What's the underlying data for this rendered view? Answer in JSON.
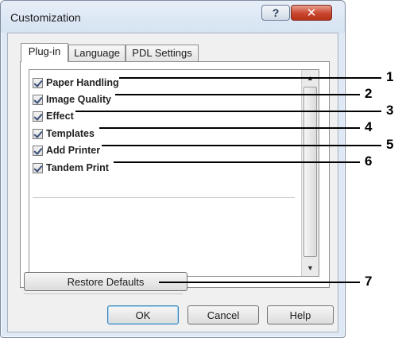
{
  "window": {
    "title": "Customization",
    "help_glyph": "?",
    "close_glyph": "✕"
  },
  "tabs": [
    {
      "label": "Plug-in",
      "active": true
    },
    {
      "label": "Language",
      "active": false
    },
    {
      "label": "PDL Settings",
      "active": false
    }
  ],
  "plugins": [
    {
      "label": "Paper Handling",
      "checked": true
    },
    {
      "label": "Image Quality",
      "checked": true
    },
    {
      "label": "Effect",
      "checked": true
    },
    {
      "label": "Templates",
      "checked": true
    },
    {
      "label": "Add Printer",
      "checked": true
    },
    {
      "label": "Tandem Print",
      "checked": true
    }
  ],
  "buttons": {
    "restore_defaults": "Restore Defaults",
    "ok": "OK",
    "cancel": "Cancel",
    "help": "Help"
  },
  "callouts": [
    "1",
    "2",
    "3",
    "4",
    "5",
    "6",
    "7"
  ],
  "icons": {
    "scroll_up": "▲",
    "scroll_down": "▼"
  },
  "colors": {
    "window_frame": "#dfe9f5",
    "close_button": "#c9452e",
    "default_button_border": "#3c7fb1"
  }
}
